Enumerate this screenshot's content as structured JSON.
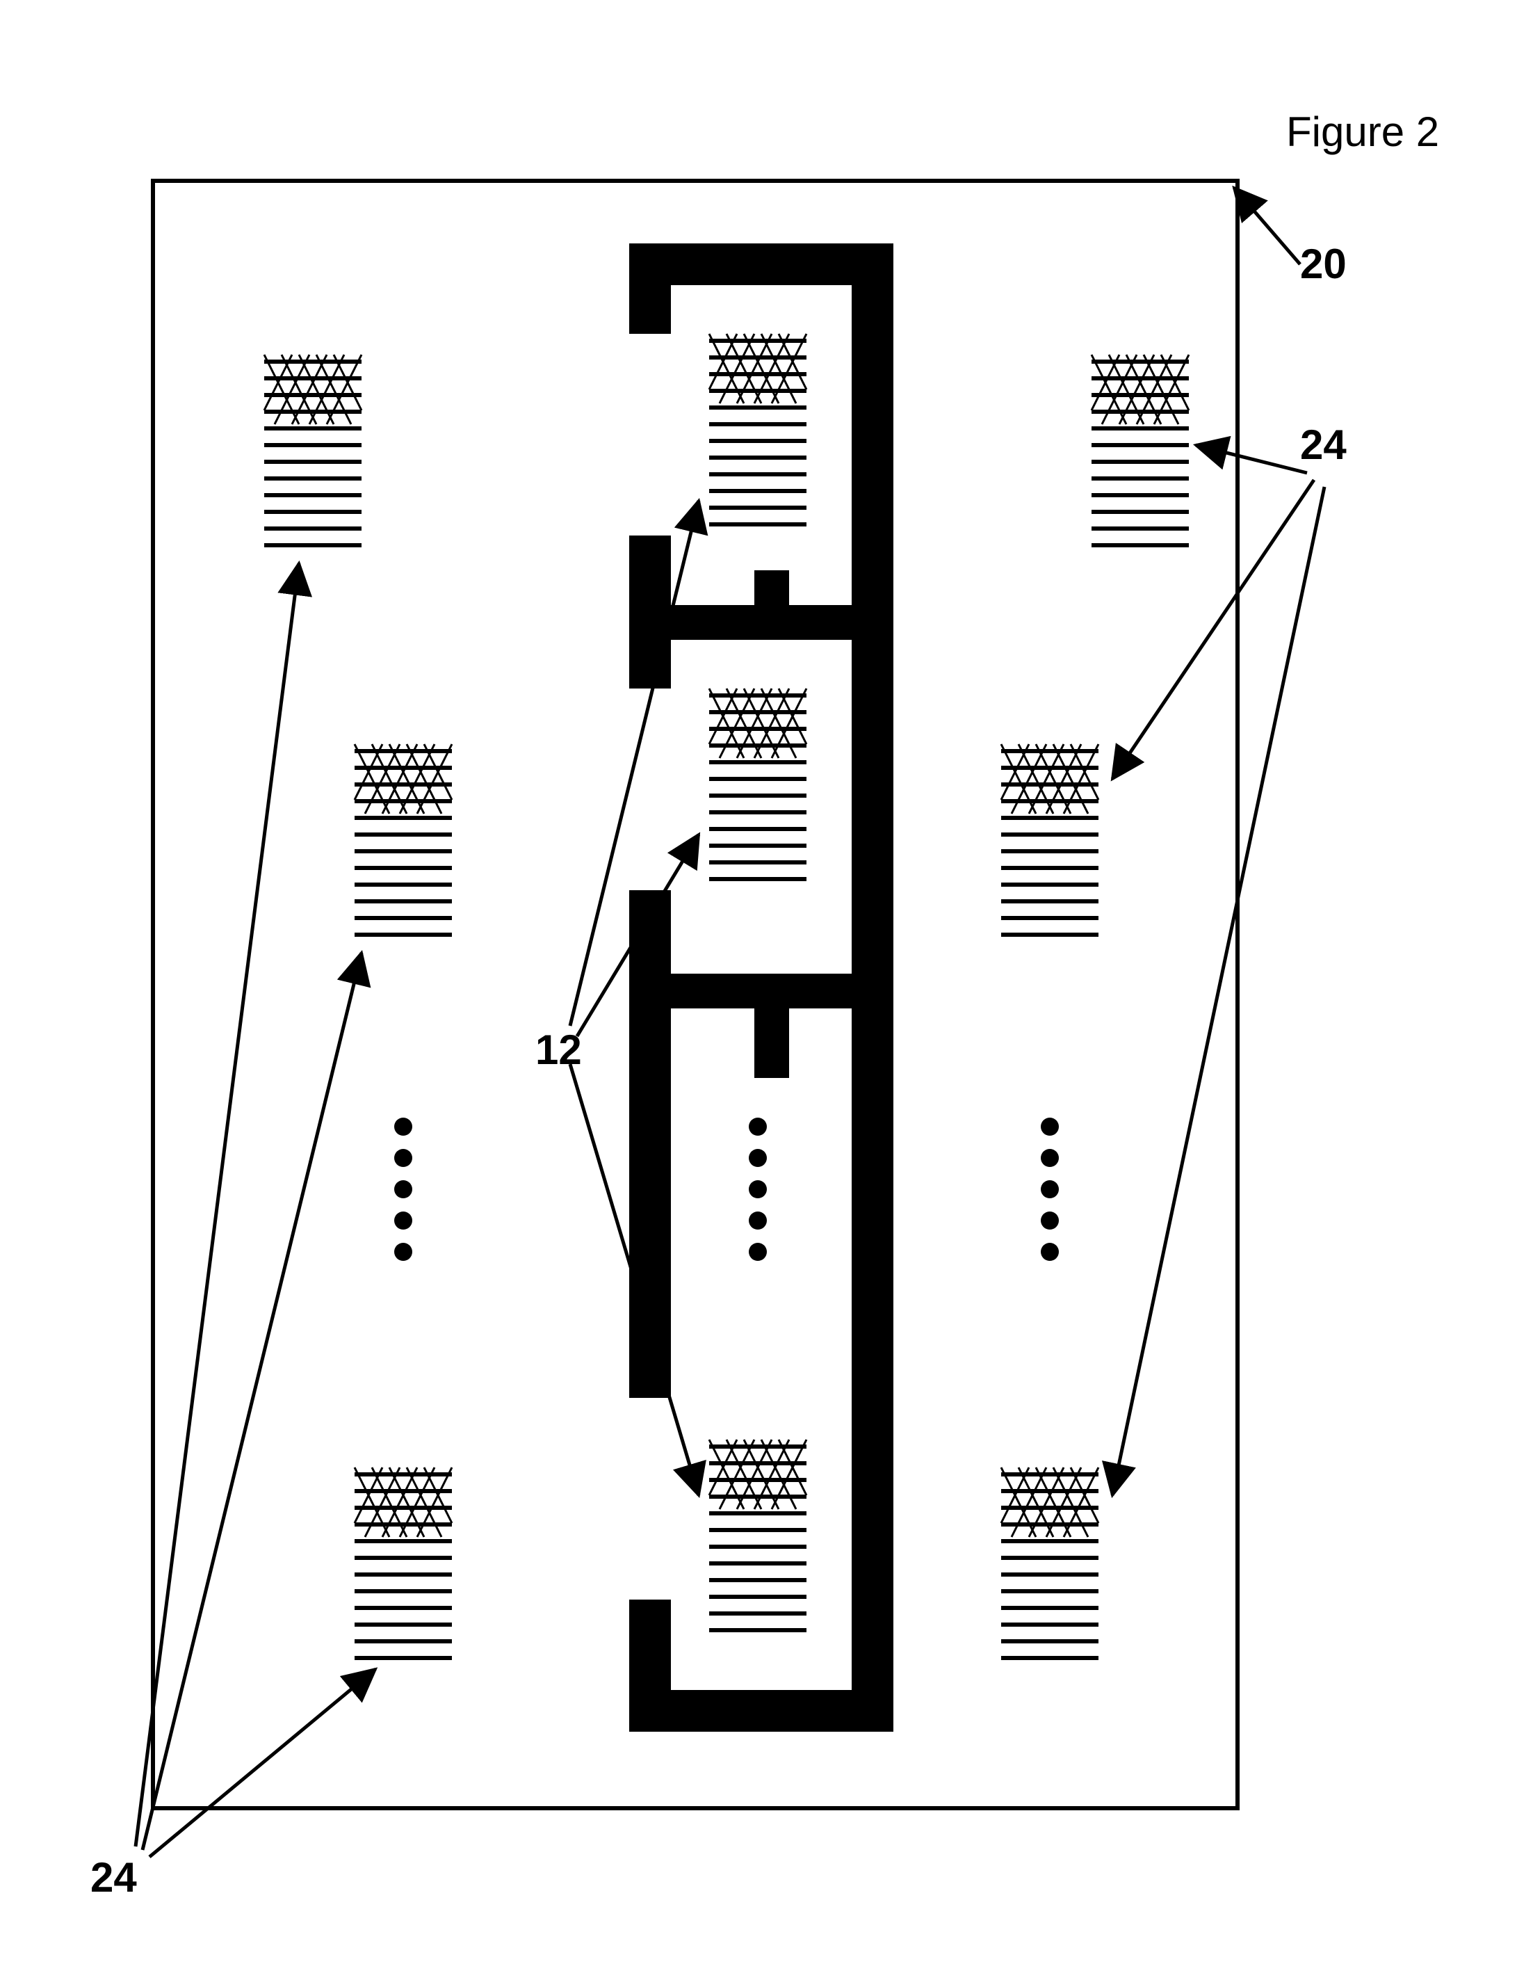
{
  "figure_label": "Figure 2",
  "callouts": {
    "substrate": "20",
    "enclosed_elements": "12",
    "free_elements_left": "24",
    "free_elements_right": "24"
  },
  "description": "Schematic plan view: a rectangular substrate (20) carries a central black enclosure housing several hatched elements (12). Additional identical hatched elements (24) lie freely on both sides of the enclosure. Vertical dot sequences indicate continuation of elements.",
  "chart_data": {
    "type": "diagram",
    "substrate_ref": 20,
    "enclosure": {
      "elements_ref": 12,
      "elements_shown": 3,
      "continuation_dots": true
    },
    "free_elements": {
      "ref": 24,
      "left_shown": 3,
      "right_shown": 3,
      "continuation_dots": true
    }
  }
}
